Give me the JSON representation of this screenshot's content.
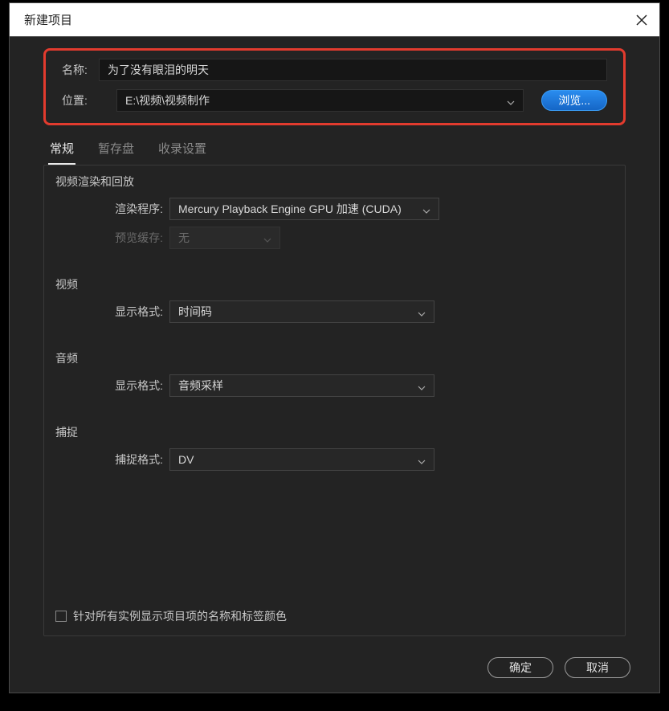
{
  "dialog": {
    "title": "新建项目"
  },
  "fields": {
    "name_label": "名称:",
    "name_value": "为了没有眼泪的明天",
    "location_label": "位置:",
    "location_value": "E:\\视频\\视频制作",
    "browse_label": "浏览..."
  },
  "tabs": {
    "general": "常规",
    "scratch": "暂存盘",
    "ingest": "收录设置"
  },
  "sections": {
    "render": {
      "title": "视频渲染和回放",
      "renderer_label": "渲染程序:",
      "renderer_value": "Mercury Playback Engine GPU 加速 (CUDA)",
      "preview_label": "预览缓存:",
      "preview_value": "无"
    },
    "video": {
      "title": "视频",
      "format_label": "显示格式:",
      "format_value": "时间码"
    },
    "audio": {
      "title": "音频",
      "format_label": "显示格式:",
      "format_value": "音频采样"
    },
    "capture": {
      "title": "捕捉",
      "format_label": "捕捉格式:",
      "format_value": "DV"
    }
  },
  "checkbox": {
    "label": "针对所有实例显示项目项的名称和标签颜色"
  },
  "buttons": {
    "ok": "确定",
    "cancel": "取消"
  }
}
